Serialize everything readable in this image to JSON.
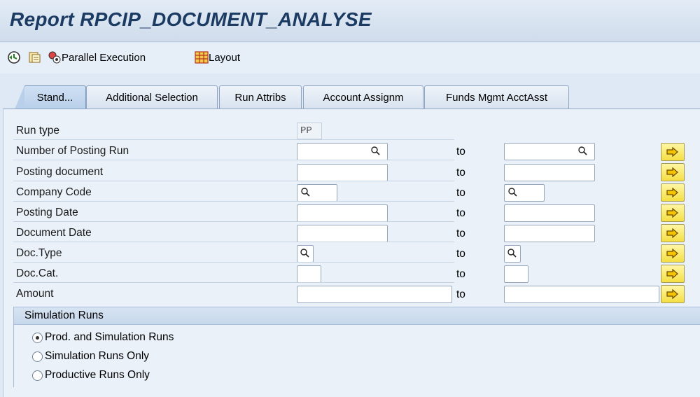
{
  "title": "Report RPCIP_DOCUMENT_ANALYSE",
  "toolbar": {
    "execute_icon": "execute-clock-icon",
    "variant_icon": "get-variant-icon",
    "parallel_label": "Parallel Execution",
    "layout_label": "Layout"
  },
  "tabs": [
    {
      "label": "Stand..."
    },
    {
      "label": "Additional Selection"
    },
    {
      "label": "Run Attribs"
    },
    {
      "label": "Account Assignm"
    },
    {
      "label": "Funds Mgmt AcctAsst"
    }
  ],
  "form": {
    "run_type": {
      "label": "Run type",
      "value": "PP"
    },
    "to_label": "to",
    "rows": [
      {
        "label": "Number of Posting Run"
      },
      {
        "label": "Posting document"
      },
      {
        "label": "Company Code"
      },
      {
        "label": "Posting Date"
      },
      {
        "label": "Document Date"
      },
      {
        "label": "Doc.Type"
      },
      {
        "label": "Doc.Cat."
      },
      {
        "label": "Amount"
      }
    ]
  },
  "simulation": {
    "header": "Simulation Runs",
    "options": [
      {
        "label": "Prod. and Simulation Runs",
        "selected": true
      },
      {
        "label": "Simulation Runs Only",
        "selected": false
      },
      {
        "label": "Productive Runs Only",
        "selected": false
      }
    ]
  },
  "colors": {
    "title": "#1c3b63",
    "arrow_button": "#f5df43"
  }
}
